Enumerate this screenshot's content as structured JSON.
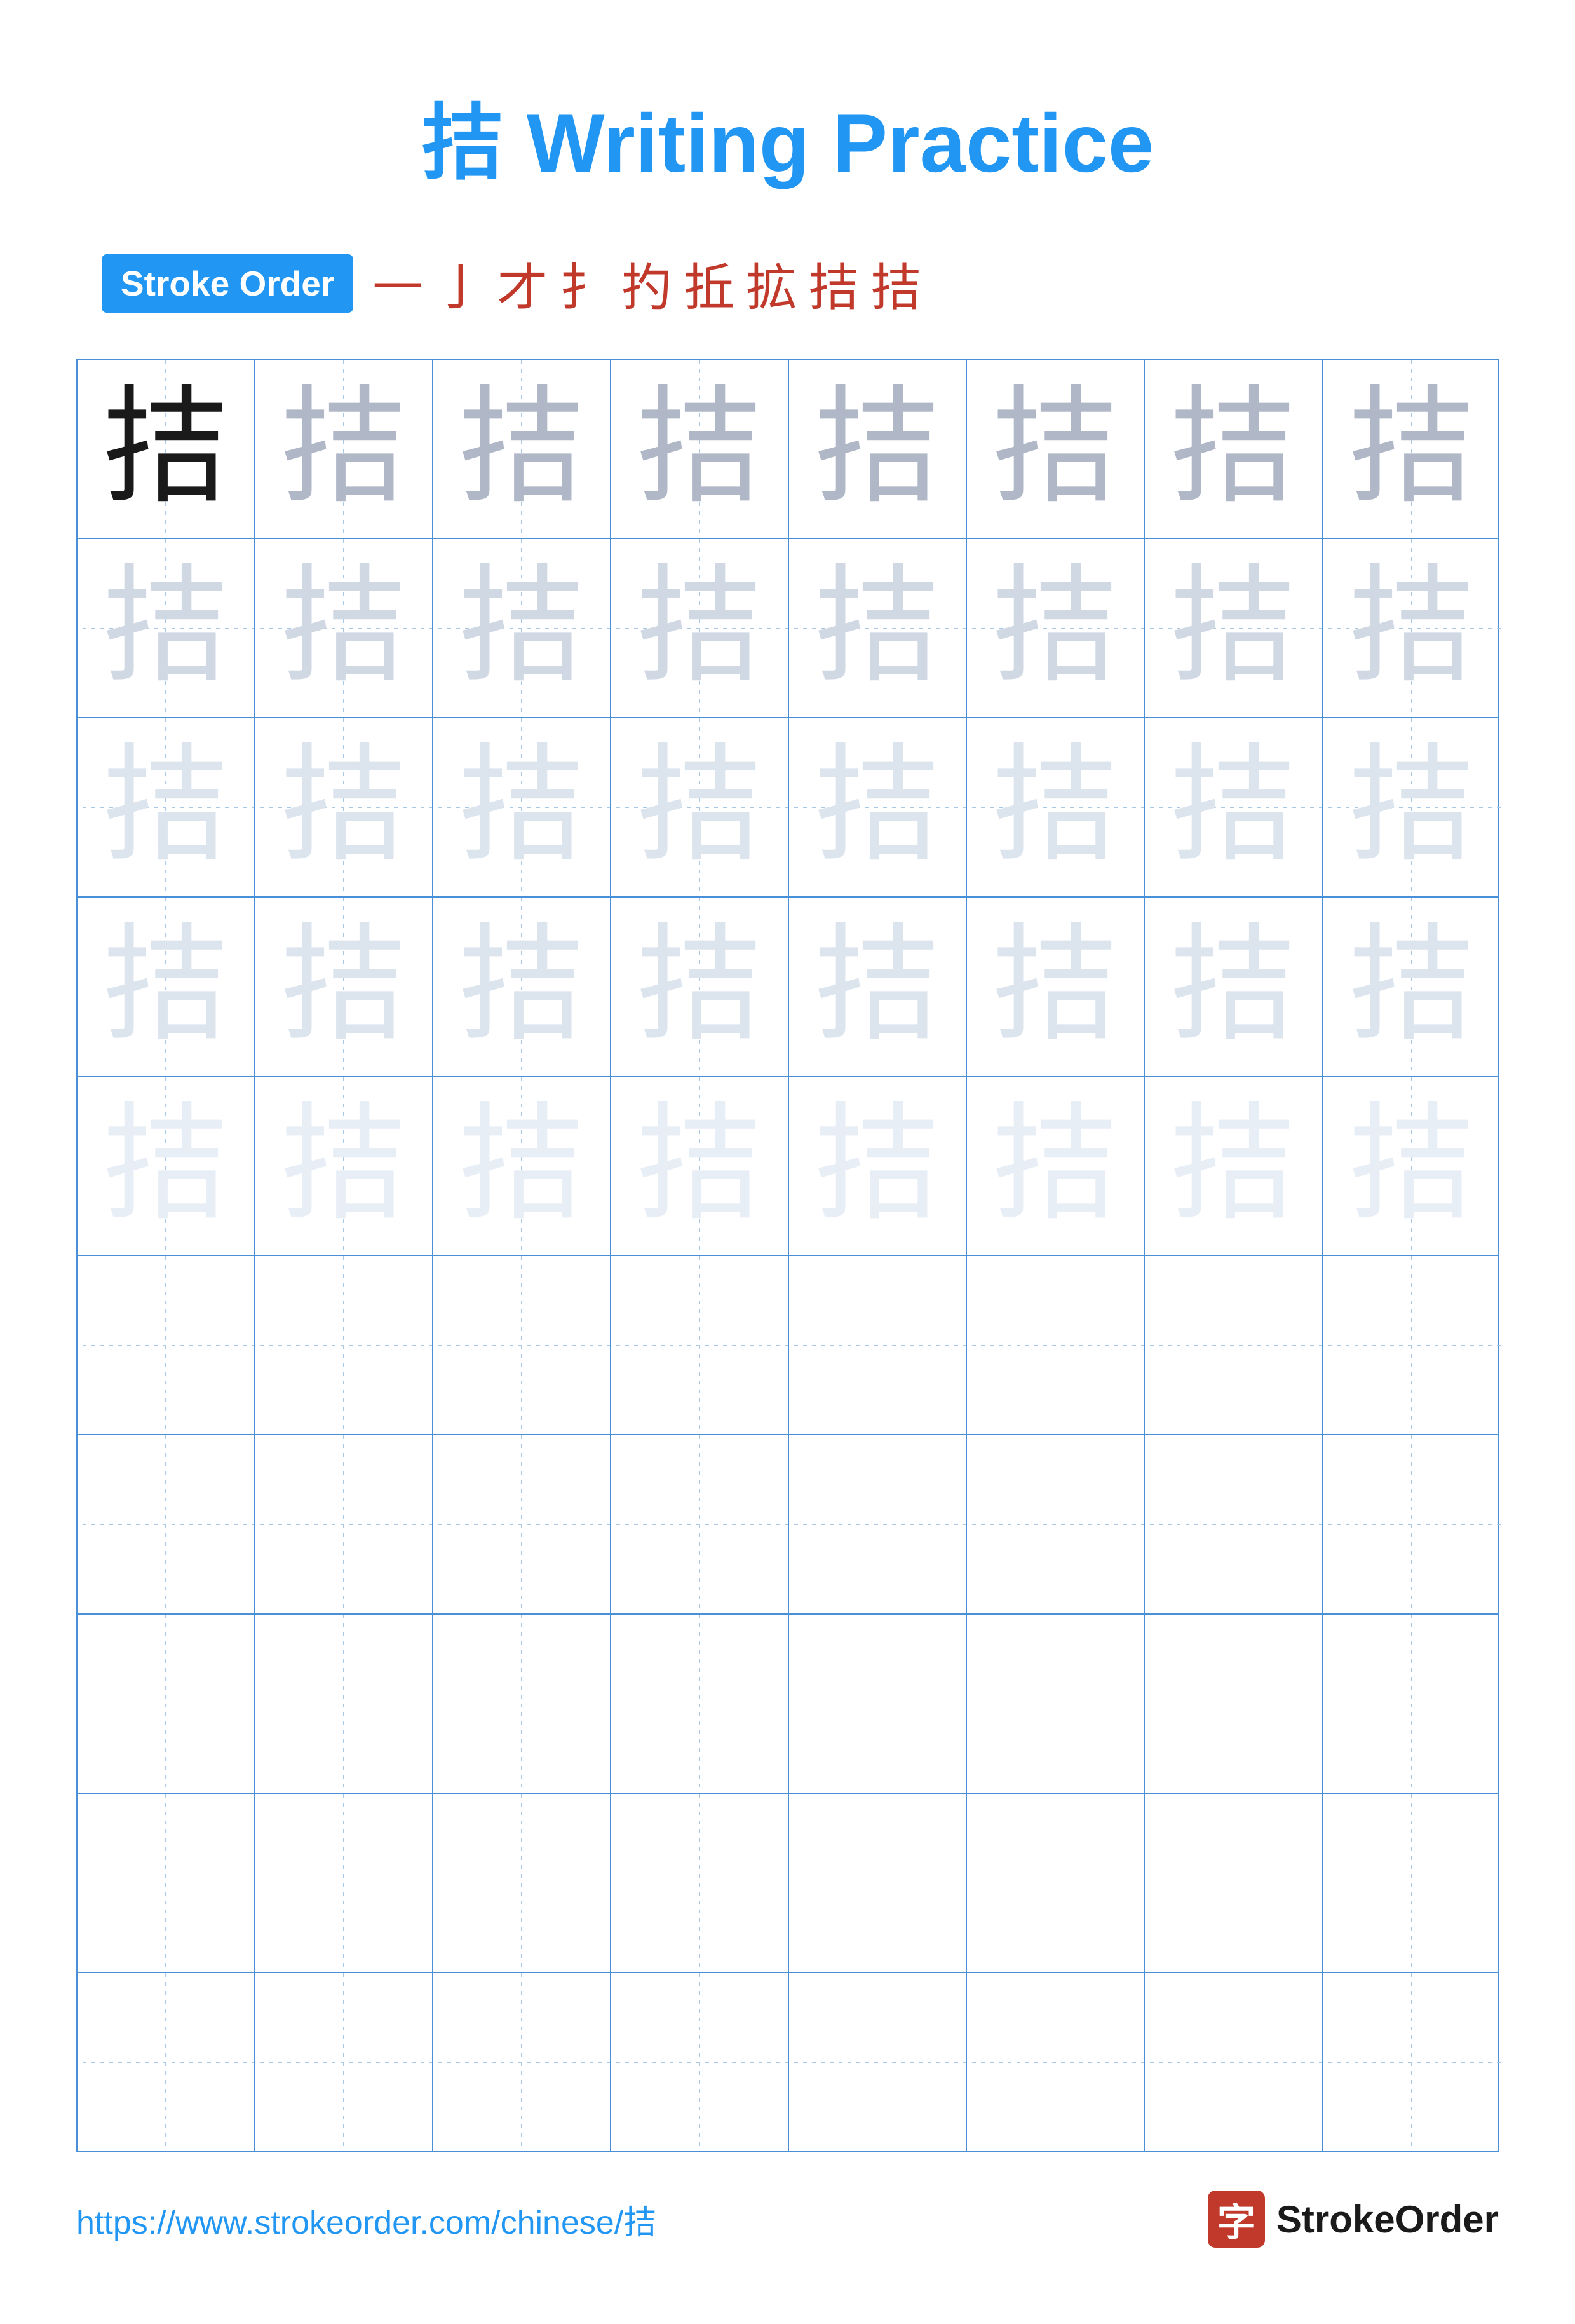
{
  "title": "拮 Writing Practice",
  "stroke_order": {
    "badge": "Stroke Order",
    "strokes": [
      "一",
      "亅",
      "才",
      "扌",
      "扚",
      "扡",
      "扢",
      "拮",
      "拮"
    ]
  },
  "character": "拮",
  "grid": {
    "rows": 10,
    "cols": 8,
    "practice_rows_with_char": 5,
    "empty_rows": 5
  },
  "footer": {
    "url": "https://www.strokeorder.com/chinese/拮",
    "brand_icon": "字",
    "brand_name": "StrokeOrder"
  }
}
